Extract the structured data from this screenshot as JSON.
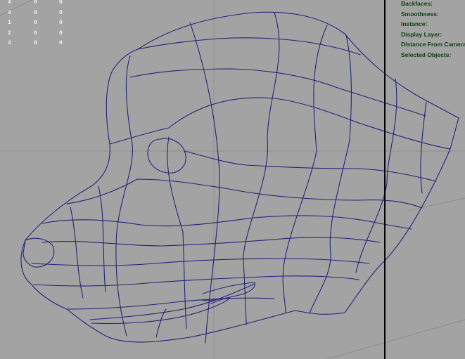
{
  "viewport": {
    "background": "#a3a3a3",
    "wire_color": "#23237a",
    "grid_color": "#8c8c8c",
    "hud_label_color": "#0d3d13"
  },
  "poly_count_hud": {
    "rows": [
      [
        "4",
        "0",
        "0"
      ],
      [
        "4",
        "0",
        "0"
      ],
      [
        "1",
        "0",
        "0"
      ],
      [
        "2",
        "0",
        "0"
      ],
      [
        "4",
        "0",
        "0"
      ]
    ]
  },
  "heads_up_display": {
    "items": [
      "Backfaces:",
      "Smoothness:",
      "Instance:",
      "Display Layer:",
      "Distance From Camera:",
      "Selected Objects:"
    ]
  }
}
